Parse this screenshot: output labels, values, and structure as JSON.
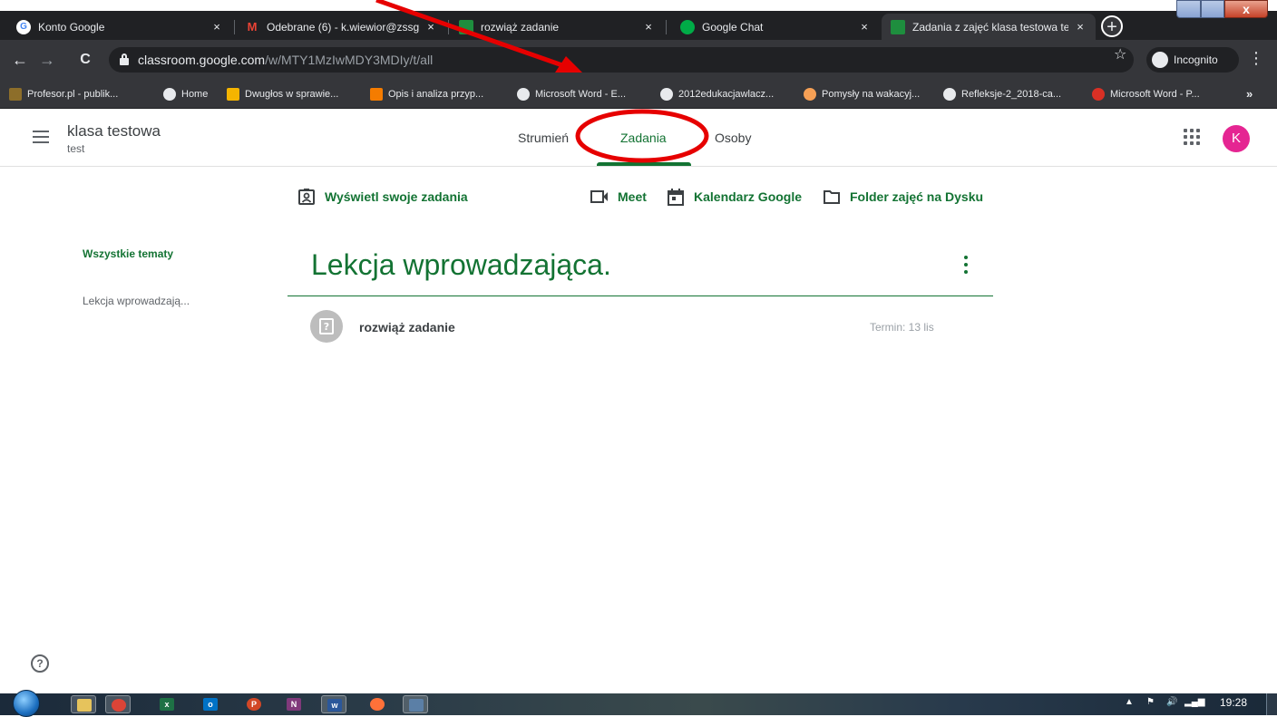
{
  "browser": {
    "tabs": [
      {
        "title": "Konto Google",
        "icon": "google-g-icon",
        "icon_color": "#4285f4",
        "close": "×"
      },
      {
        "title": "Odebrane (6) - k.wiewior@zssg",
        "icon": "gmail-m-icon",
        "icon_color": "#ea4335",
        "close": "×"
      },
      {
        "title": "rozwiąż zadanie",
        "icon": "classroom-icon",
        "icon_color": "#1e8e3e",
        "close": "×"
      },
      {
        "title": "Google Chat",
        "icon": "google-chat-icon",
        "icon_color": "#00ac47",
        "close": "×"
      },
      {
        "title": "Zadania z zajęć klasa testowa te",
        "icon": "classroom-icon",
        "icon_color": "#1e8e3e",
        "close": "×"
      }
    ],
    "new_tab": "+",
    "close_window": "x",
    "nav": {
      "back": "←",
      "forward": "→",
      "reload": "C"
    },
    "url_host": "classroom.google.com",
    "url_path": "/w/MTY1MzIwMDY3MDIy/t/all",
    "star": "☆",
    "incognito_label": "Incognito",
    "menu": "⋮",
    "bookmarks": [
      {
        "label": "Profesor.pl - publik...",
        "icon_color": "#8d6e2a"
      },
      {
        "label": "Home",
        "icon_color": "#e8eaed"
      },
      {
        "label": "Dwugłos w sprawie...",
        "icon_color": "#f4b400"
      },
      {
        "label": "Opis i analiza przyp...",
        "icon_color": "#f57c00"
      },
      {
        "label": "Microsoft Word - E...",
        "icon_color": "#e8eaed"
      },
      {
        "label": "2012edukacjawlacz...",
        "icon_color": "#e8eaed"
      },
      {
        "label": "Pomysły na wakacyj...",
        "icon_color": "#f6a055"
      },
      {
        "label": "Refleksje-2_2018-ca...",
        "icon_color": "#e8eaed"
      },
      {
        "label": "Microsoft Word - P...",
        "icon_color": "#d93025"
      }
    ],
    "bookmarks_more": "»"
  },
  "classroom": {
    "class_name": "klasa testowa",
    "class_section": "test",
    "nav_tabs": [
      "Strumień",
      "Zadania",
      "Osoby"
    ],
    "active_tab": "Zadania",
    "avatar_letter": "K",
    "accent_color": "#137333",
    "actions": {
      "view_work": "Wyświetl swoje zadania",
      "meet": "Meet",
      "calendar": "Kalendarz Google",
      "drive_folder": "Folder zajęć na Dysku"
    },
    "topics": {
      "all": "Wszystkie tematy",
      "items": [
        "Lekcja wprowadzają..."
      ]
    },
    "section": {
      "heading": "Lekcja wprowadzająca.",
      "assignment_title": "rozwiąż zadanie",
      "assignment_due": "Termin: 13 lis",
      "assignment_icon": "question-icon"
    },
    "help": "?"
  },
  "taskbar": {
    "apps": [
      "explorer-icon",
      "chrome-icon",
      "excel-icon",
      "outlook-icon",
      "powerpoint-icon",
      "onenote-icon",
      "word-icon",
      "firefox-icon",
      "paint-icon"
    ],
    "clock": "19:28"
  },
  "annotation": {
    "color": "#e60000"
  }
}
